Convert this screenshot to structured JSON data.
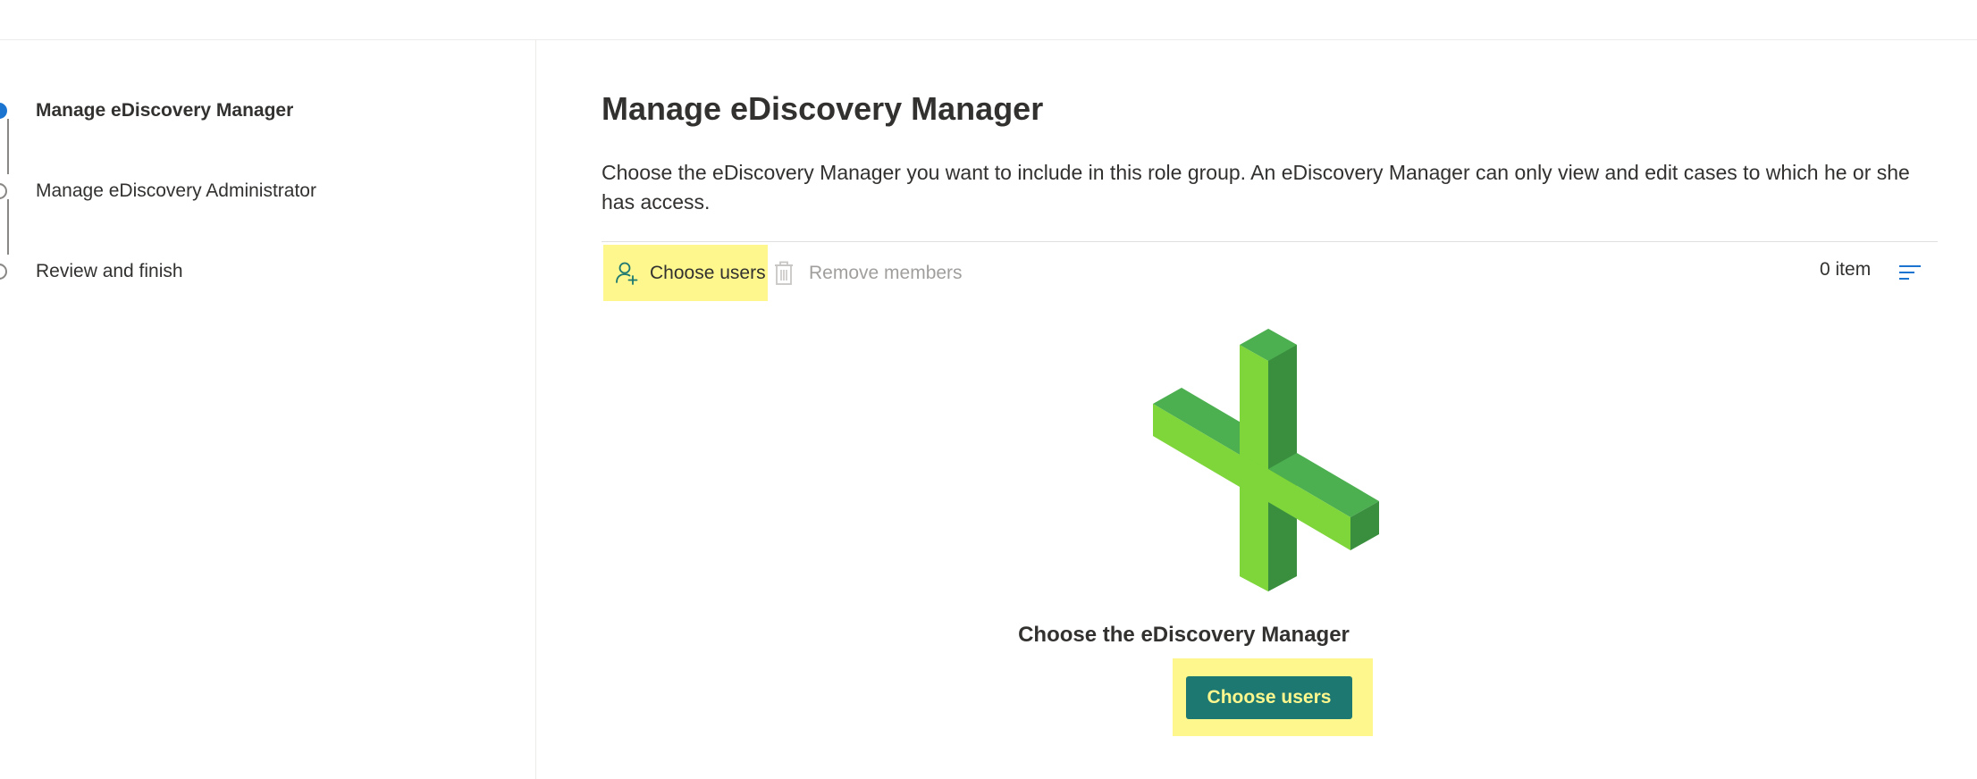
{
  "steps": [
    {
      "label": "Manage eDiscovery Manager",
      "state": "active"
    },
    {
      "label": "Manage eDiscovery Administrator",
      "state": "pending"
    },
    {
      "label": "Review and finish",
      "state": "pending"
    }
  ],
  "main": {
    "title": "Manage eDiscovery Manager",
    "description": "Choose the eDiscovery Manager you want to include in this role group. An eDiscovery Manager can only view and edit cases to which he or she has access.",
    "toolbar": {
      "choose_users_label": "Choose users",
      "choose_users_icon": "add-person-icon",
      "remove_members_label": "Remove members",
      "remove_members_icon": "trash-icon",
      "item_count": "0 item",
      "sort_icon": "sort-lines-icon"
    },
    "empty_state": {
      "illustration": "green-plus-3d-icon",
      "title": "Choose the eDiscovery Manager",
      "button_label": "Choose users"
    }
  },
  "colors": {
    "accent_blue": "#1a74d0",
    "highlight_yellow": "#fdf78e",
    "button_teal": "#1c7871",
    "plus_light": "#7ed63a",
    "plus_mid": "#4caf50",
    "plus_dark": "#3a8f3f"
  }
}
